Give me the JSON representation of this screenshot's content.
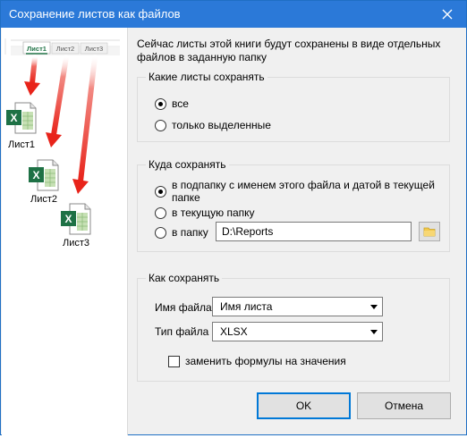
{
  "window": {
    "title": "Сохранение листов как файлов"
  },
  "illustration": {
    "tabs": [
      "Лист1",
      "Лист2",
      "Лист3"
    ],
    "files": [
      "Лист1",
      "Лист2",
      "Лист3"
    ]
  },
  "intro_text": "Сейчас листы этой книги будут сохранены в виде отдельных файлов в заданную папку",
  "which_sheets": {
    "label": "Какие листы сохранять",
    "options": [
      "все",
      "только выделенные"
    ],
    "selected": "все"
  },
  "where_save": {
    "label": "Куда сохранять",
    "options": [
      "в подпапку с именем этого файла и датой в текущей папке",
      "в текущую папку",
      "в папку"
    ],
    "selected": "в подпапку с именем этого файла и датой в текущей папке",
    "folder_path": "D:\\Reports"
  },
  "how_save": {
    "label": "Как сохранять",
    "filename_label": "Имя файла",
    "filename_value": "Имя листа",
    "filetype_label": "Тип файла",
    "filetype_value": "XLSX",
    "replace_formulas_label": "заменить формулы на значения",
    "replace_formulas_checked": false
  },
  "buttons": {
    "ok": "OK",
    "cancel": "Отмена"
  },
  "colors": {
    "titlebar": "#2b79d8",
    "excel_green": "#1e7145",
    "arrow_red": "#e8231a"
  }
}
